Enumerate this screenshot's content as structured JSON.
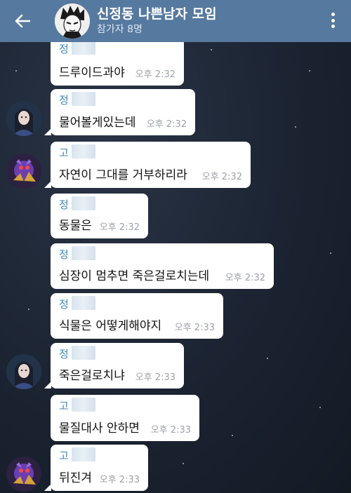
{
  "header": {
    "title": "신정동 나쁜남자 모임",
    "subtitle": "참가자 8명",
    "back_icon": "arrow-left-icon",
    "menu_icon": "more-vertical-icon"
  },
  "colors": {
    "header_bg": "#56799f",
    "bubble_bg": "#ffffff",
    "sender_color": "#3f86b8",
    "time_color": "#9aa2ab"
  },
  "messages": [
    {
      "sender": "정",
      "text": "드루이드과야",
      "time": "오후 2:32"
    },
    {
      "sender": "정",
      "text": "물어볼게있는데",
      "time": "오후 2:32"
    },
    {
      "sender": "고",
      "text": "자연이 그대를 거부하리라",
      "time": "오후 2:32"
    },
    {
      "sender": "정",
      "text": "동물은",
      "time": "오후 2:32"
    },
    {
      "sender": "정",
      "text": "심장이 멈추면 죽은걸로치는데",
      "time": "오후 2:32"
    },
    {
      "sender": "정",
      "text": "식물은 어떻게해야지",
      "time": "오후 2:33"
    },
    {
      "sender": "정",
      "text": "죽은걸로치냐",
      "time": "오후 2:33"
    },
    {
      "sender": "고",
      "text": "물질대사 안하면",
      "time": "오후 2:33"
    },
    {
      "sender": "고",
      "text": "뒤진겨",
      "time": "오후 2:33"
    }
  ]
}
